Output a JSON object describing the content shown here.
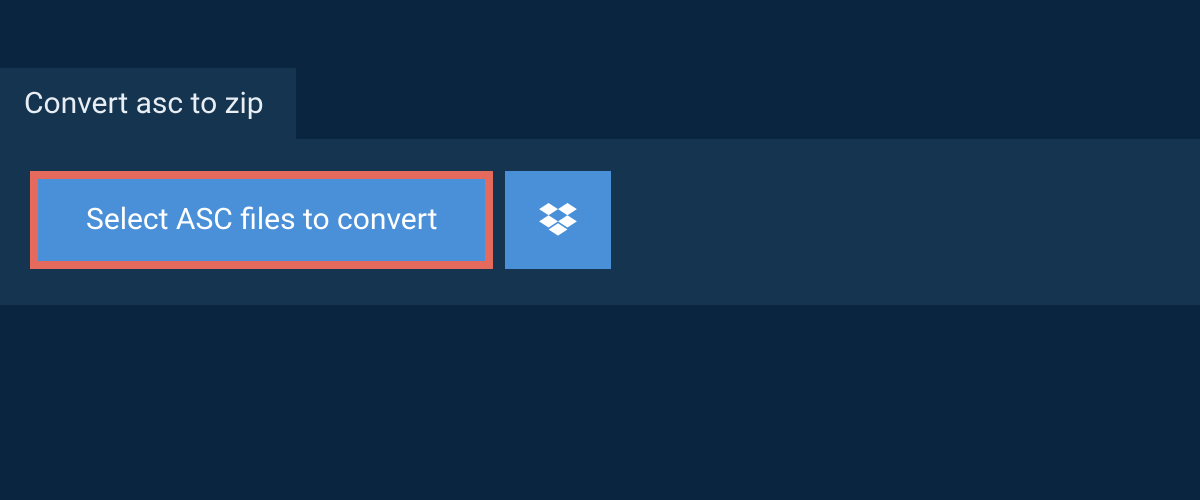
{
  "header": {
    "tab_label": "Convert asc to zip"
  },
  "actions": {
    "select_button_label": "Select ASC files to convert"
  },
  "colors": {
    "background": "#0a2540",
    "panel": "#14344f",
    "button": "#4a90d9",
    "highlight_border": "#e36a5c",
    "text_light": "#ffffff"
  }
}
